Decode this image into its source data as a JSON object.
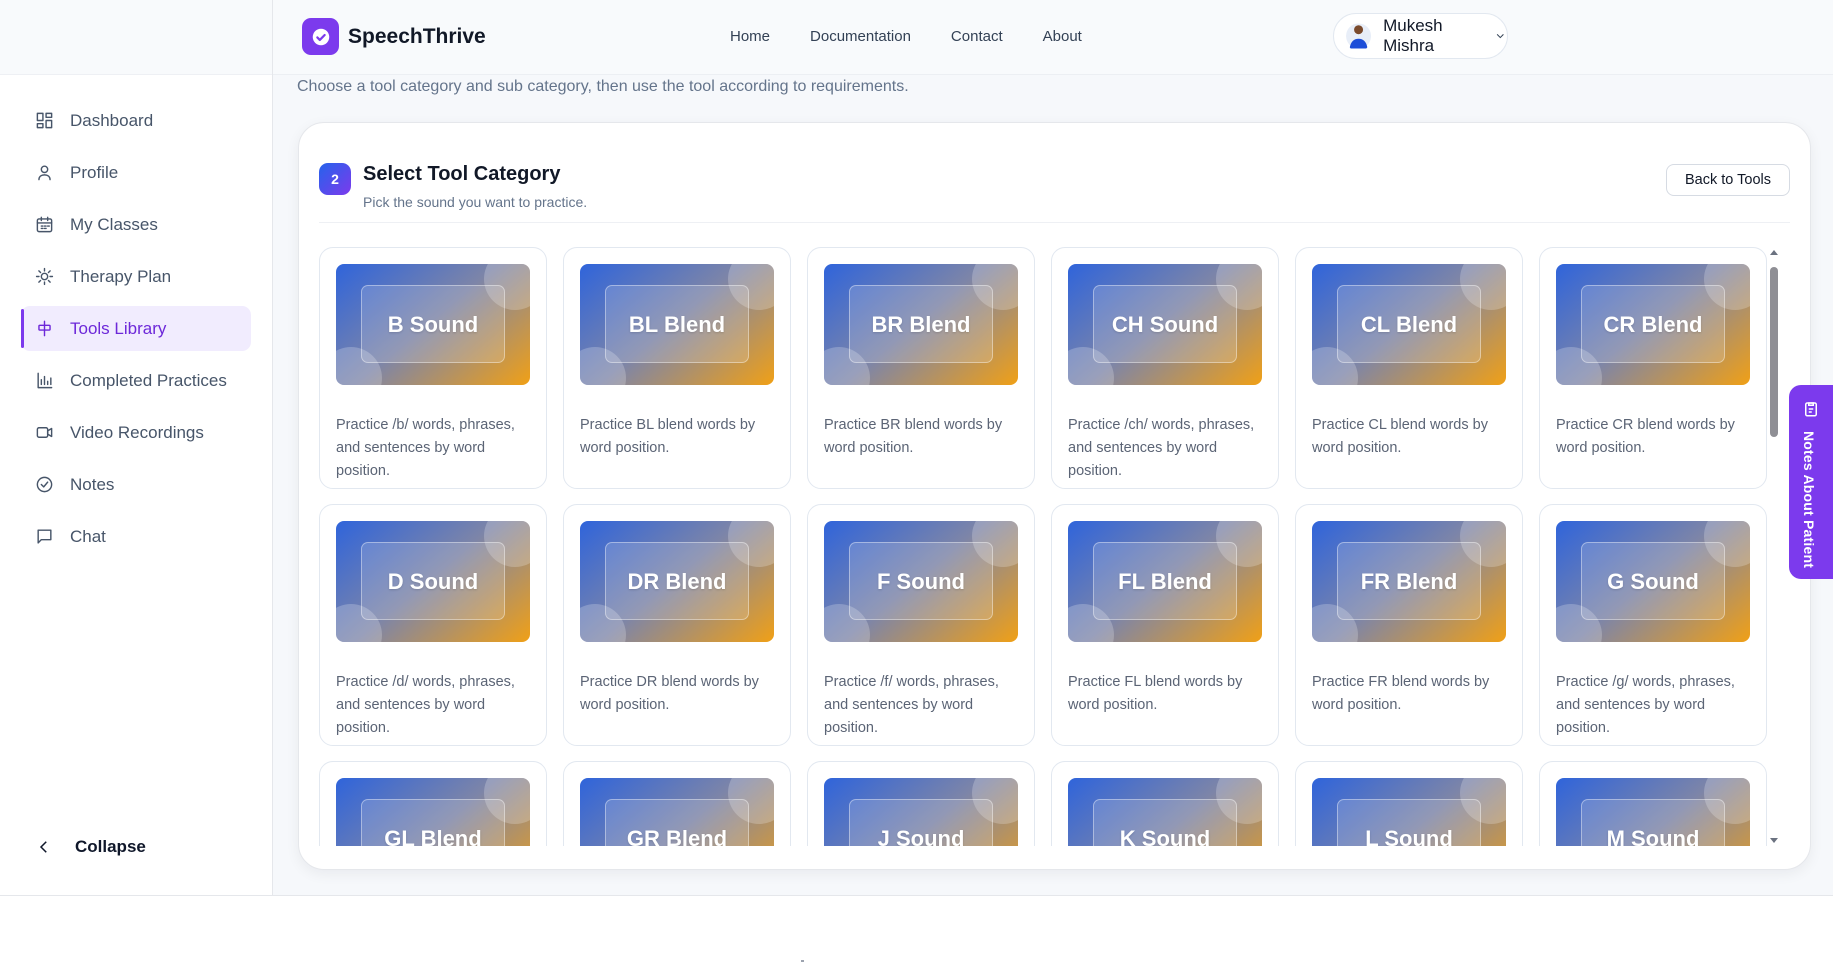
{
  "brand": {
    "name": "SpeechThrive"
  },
  "top_nav": {
    "links": [
      "Home",
      "Documentation",
      "Contact",
      "About"
    ]
  },
  "user": {
    "name": "Mukesh Mishra"
  },
  "sidebar": {
    "items": [
      {
        "label": "Dashboard",
        "icon": "grid-icon",
        "active": false
      },
      {
        "label": "Profile",
        "icon": "user-icon",
        "active": false
      },
      {
        "label": "My Classes",
        "icon": "calendar-icon",
        "active": false
      },
      {
        "label": "Therapy Plan",
        "icon": "sun-icon",
        "active": false
      },
      {
        "label": "Tools Library",
        "icon": "tools-icon",
        "active": true
      },
      {
        "label": "Completed Practices",
        "icon": "bar-chart-icon",
        "active": false
      },
      {
        "label": "Video Recordings",
        "icon": "video-icon",
        "active": false
      },
      {
        "label": "Notes",
        "icon": "check-circle-icon",
        "active": false
      },
      {
        "label": "Chat",
        "icon": "message-icon",
        "active": false
      }
    ],
    "collapse_label": "Collapse"
  },
  "main": {
    "subtitle": "Choose a tool category and sub category, then use the tool according to requirements.",
    "step_number": "2",
    "title": "Select Tool Category",
    "subtitle_small": "Pick the sound you want to practice.",
    "back_label": "Back to Tools",
    "cards": [
      {
        "title": "B Sound",
        "desc": "Practice /b/ words, phrases, and sentences by word position."
      },
      {
        "title": "BL Blend",
        "desc": "Practice BL blend words by word position."
      },
      {
        "title": "BR Blend",
        "desc": "Practice BR blend words by word position."
      },
      {
        "title": "CH Sound",
        "desc": "Practice /ch/ words, phrases, and sentences by word position."
      },
      {
        "title": "CL Blend",
        "desc": "Practice CL blend words by word position."
      },
      {
        "title": "CR Blend",
        "desc": "Practice CR blend words by word position."
      },
      {
        "title": "D Sound",
        "desc": "Practice /d/ words, phrases, and sentences by word position."
      },
      {
        "title": "DR Blend",
        "desc": "Practice DR blend words by word position."
      },
      {
        "title": "F Sound",
        "desc": "Practice /f/ words, phrases, and sentences by word position."
      },
      {
        "title": "FL Blend",
        "desc": "Practice FL blend words by word position."
      },
      {
        "title": "FR Blend",
        "desc": "Practice FR blend words by word position."
      },
      {
        "title": "G Sound",
        "desc": "Practice /g/ words, phrases, and sentences by word position."
      },
      {
        "title": "GL Blend",
        "desc": ""
      },
      {
        "title": "GR Blend",
        "desc": ""
      },
      {
        "title": "J Sound",
        "desc": ""
      },
      {
        "title": "K Sound",
        "desc": ""
      },
      {
        "title": "L Sound",
        "desc": ""
      },
      {
        "title": "M Sound",
        "desc": ""
      }
    ]
  },
  "notes_tab": {
    "label": "Notes About Patient"
  },
  "colors": {
    "accent": "#7c3aed",
    "active_bg": "#f1ecfe",
    "card_gradient_start": "#2f64db",
    "card_gradient_end": "#f0a016"
  }
}
